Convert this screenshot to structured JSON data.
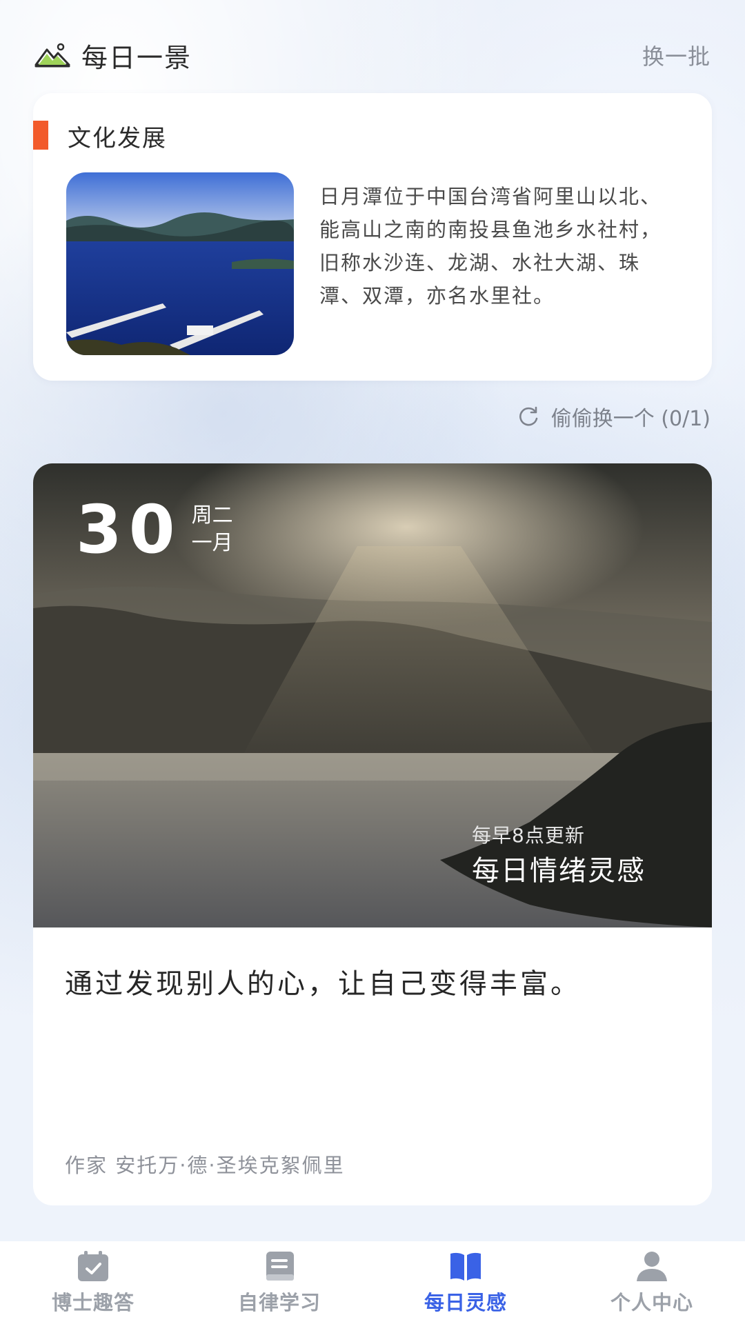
{
  "header": {
    "title": "每日一景",
    "refresh_batch": "换一批"
  },
  "culture_card": {
    "category": "文化发展",
    "description": "日月潭位于中国台湾省阿里山以北、能高山之南的南投县鱼池乡水社村，旧称水沙连、龙湖、水社大湖、珠潭、双潭，亦名水里社。"
  },
  "swap": {
    "label": "偷偷换一个 (0/1)"
  },
  "inspiration": {
    "day": "30",
    "weekday": "周二",
    "month": "一月",
    "update_note": "每早8点更新",
    "title": "每日情绪灵感",
    "quote": "通过发现别人的心，让自己变得丰富。",
    "author": "作家 安托万·德·圣埃克絮佩里"
  },
  "tabbar": {
    "items": [
      {
        "label": "博士趣答",
        "icon": "calendar-check-icon",
        "active": false
      },
      {
        "label": "自律学习",
        "icon": "book-icon",
        "active": false
      },
      {
        "label": "每日灵感",
        "icon": "open-book-icon",
        "active": true
      },
      {
        "label": "个人中心",
        "icon": "user-icon",
        "active": false
      }
    ]
  },
  "colors": {
    "accent": "#3a62e6",
    "category_bar": "#f25a2b",
    "inactive_tab": "#9ca1a9"
  }
}
